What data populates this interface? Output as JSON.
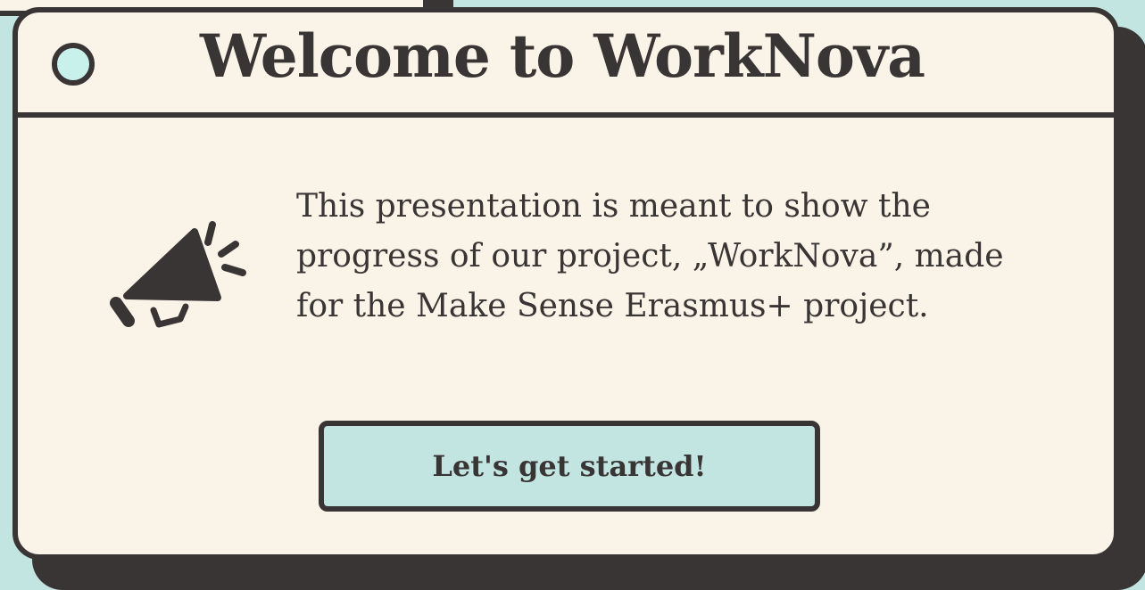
{
  "window": {
    "title": "Welcome to WorkNova"
  },
  "content": {
    "icon": "megaphone-icon",
    "lines": [
      "This presentation is meant to show the",
      "progress of our project, „WorkNova”, made",
      "for the Make Sense Erasmus+ project."
    ]
  },
  "actions": {
    "start_label": "Let's get started!"
  },
  "colors": {
    "background": "#c2e5e2",
    "window": "#faf4e8",
    "outline": "#3a3535",
    "accent": "#c9f1ec"
  }
}
